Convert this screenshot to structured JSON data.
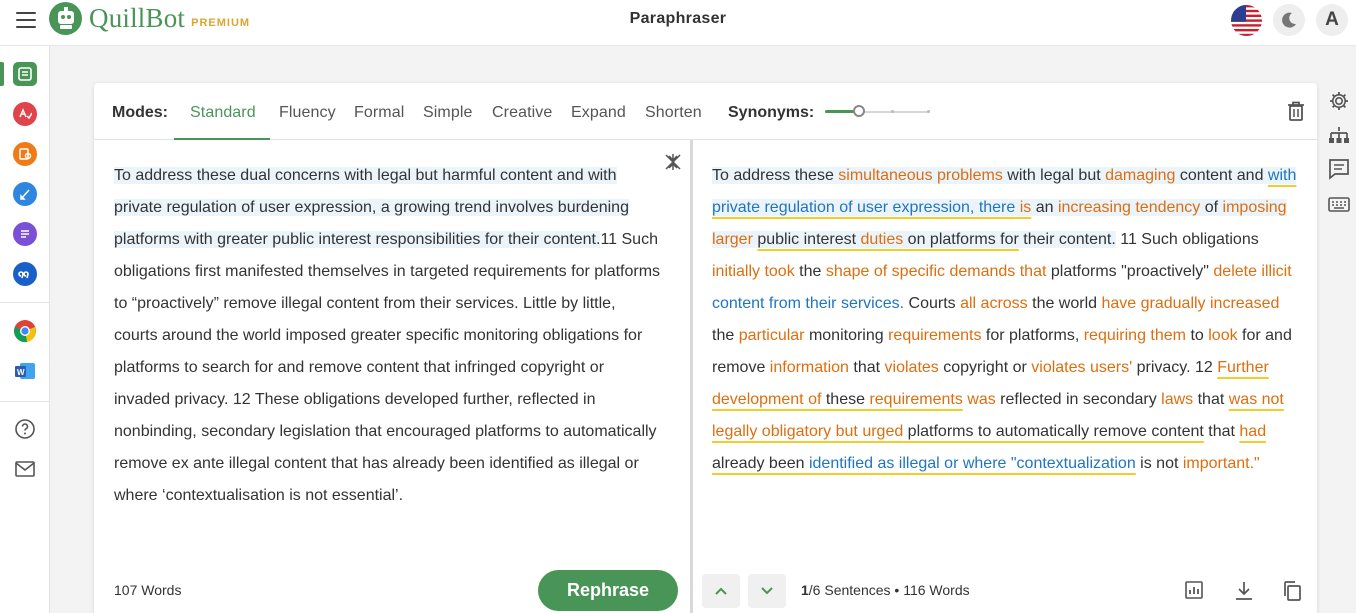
{
  "app": {
    "brand": "QuillBot",
    "tier": "PREMIUM",
    "title": "Paraphraser",
    "avatar_letter": "A",
    "brand_color": "#499557"
  },
  "toolbar": {
    "modes_label": "Modes:",
    "modes": [
      "Standard",
      "Fluency",
      "Formal",
      "Simple",
      "Creative",
      "Expand",
      "Shorten"
    ],
    "active_mode": "Standard",
    "synonyms_label": "Synonyms:",
    "synonyms_level": 0.3
  },
  "sidebar": {
    "items": [
      {
        "icon": "paraphraser-icon",
        "color": "#499557"
      },
      {
        "icon": "grammar-checker-icon",
        "color": "#e0434a"
      },
      {
        "icon": "plagiarism-checker-icon",
        "color": "#f07b16"
      },
      {
        "icon": "co-writer-icon",
        "color": "#2f86e0"
      },
      {
        "icon": "summarizer-icon",
        "color": "#7950d6"
      },
      {
        "icon": "citation-generator-icon",
        "color": "#1a5fc7"
      },
      {
        "icon": "chrome-extension-icon",
        "color": "#db4437"
      },
      {
        "icon": "word-addin-icon",
        "color": "#2b5eb3"
      },
      {
        "icon": "help-icon",
        "color": "#555555"
      },
      {
        "icon": "mail-icon",
        "color": "#555555"
      }
    ]
  },
  "input": {
    "highlighted": "To address these dual concerns with legal but harmful content and with private regulation of user expression, a growing trend involves burdening platforms with greater public interest responsibilities for their content.",
    "rest": "11 Such obligations first manifested themselves in targeted requirements for platforms to “proactively” remove illegal content from their services. Little by little, courts around the world imposed greater specific monitoring obligations for platforms to search for and remove content that infringed copyright or invaded privacy. 12 These obligations developed further, reflected in nonbinding, secondary legislation that encouraged platforms to automatically remove ex ante illegal content that has already been identified as illegal or where ‘contextualisation is not essential’.",
    "word_count": "107 Words",
    "rephrase_label": "Rephrase"
  },
  "output": {
    "segments": [
      {
        "t": "To address these ",
        "c": "n",
        "hl": true
      },
      {
        "t": "simultaneous problems",
        "c": "or",
        "hl": true
      },
      {
        "t": " with legal but ",
        "c": "n",
        "hl": true
      },
      {
        "t": "damaging",
        "c": "or",
        "hl": true
      },
      {
        "t": " content",
        "c": "n",
        "hl": true
      },
      {
        "t": " and ",
        "c": "n",
        "hl": true
      },
      {
        "t": "with private regulation of user expression, there",
        "c": "bl",
        "hl": true,
        "u": true
      },
      {
        "t": " is",
        "c": "or",
        "hl": true,
        "u": true
      },
      {
        "t": " an ",
        "c": "n",
        "hl": true
      },
      {
        "t": "increasing",
        "c": "or",
        "hl": true
      },
      {
        "t": " ",
        "c": "n",
        "hl": true
      },
      {
        "t": "tendency",
        "c": "or",
        "hl": true
      },
      {
        "t": " of ",
        "c": "n",
        "hl": true
      },
      {
        "t": "imposing larger",
        "c": "or",
        "hl": true
      },
      {
        "t": " ",
        "c": "n",
        "hl": true
      },
      {
        "t": "public interest ",
        "c": "n",
        "hl": true,
        "u": true
      },
      {
        "t": "duties",
        "c": "or",
        "hl": true,
        "u": true
      },
      {
        "t": " on platforms for",
        "c": "n",
        "hl": true,
        "u": true
      },
      {
        "t": " their content.",
        "c": "n",
        "hl": true
      },
      {
        "t": " 11 Such obligations ",
        "c": "n"
      },
      {
        "t": "initially took",
        "c": "or"
      },
      {
        "t": " the ",
        "c": "n"
      },
      {
        "t": "shape of specific demands that",
        "c": "or"
      },
      {
        "t": " platforms \"proactively\" ",
        "c": "n"
      },
      {
        "t": "delete illicit",
        "c": "or"
      },
      {
        "t": " ",
        "c": "n"
      },
      {
        "t": "content from their services.",
        "c": "bl"
      },
      {
        "t": " Courts ",
        "c": "n"
      },
      {
        "t": "all across",
        "c": "or"
      },
      {
        "t": " the world ",
        "c": "n"
      },
      {
        "t": "have gradually increased",
        "c": "or"
      },
      {
        "t": " the ",
        "c": "n"
      },
      {
        "t": "particular",
        "c": "or"
      },
      {
        "t": " monitoring ",
        "c": "n"
      },
      {
        "t": "requirements",
        "c": "or"
      },
      {
        "t": " for platforms, ",
        "c": "n"
      },
      {
        "t": "requiring them",
        "c": "or"
      },
      {
        "t": " to ",
        "c": "n"
      },
      {
        "t": "look",
        "c": "or"
      },
      {
        "t": " for and remove ",
        "c": "n"
      },
      {
        "t": "information",
        "c": "or"
      },
      {
        "t": " that ",
        "c": "n"
      },
      {
        "t": "violates",
        "c": "or"
      },
      {
        "t": " copyright or ",
        "c": "n"
      },
      {
        "t": "violates users'",
        "c": "or"
      },
      {
        "t": " privacy. 12 ",
        "c": "n"
      },
      {
        "t": "Further development of",
        "c": "or",
        "u": true
      },
      {
        "t": " these ",
        "c": "n",
        "u": true
      },
      {
        "t": "requirements",
        "c": "or",
        "u": true
      },
      {
        "t": " ",
        "c": "n"
      },
      {
        "t": "was",
        "c": "or"
      },
      {
        "t": " reflected in secondary ",
        "c": "n"
      },
      {
        "t": "laws",
        "c": "or"
      },
      {
        "t": " that ",
        "c": "n"
      },
      {
        "t": "was not",
        "c": "or",
        "u": true
      },
      {
        "t": " ",
        "c": "n",
        "u": true
      },
      {
        "t": "legally obligatory but urged",
        "c": "or",
        "u": true
      },
      {
        "t": " platforms to automatically remove content",
        "c": "n",
        "u": true
      },
      {
        "t": " that ",
        "c": "n"
      },
      {
        "t": "had",
        "c": "or",
        "u": true
      },
      {
        "t": " already been ",
        "c": "n",
        "u": true
      },
      {
        "t": "identified as illegal or where \"contextualization",
        "c": "bl",
        "u": true
      },
      {
        "t": " is not ",
        "c": "n"
      },
      {
        "t": "important.\"",
        "c": "or"
      }
    ],
    "sentence_info": "1/6 Sentences",
    "bullet": "•",
    "word_count": "116 Words"
  },
  "colors": {
    "changed_word": "#dd6e0f",
    "structural_change": "#1f74c4",
    "longest_unchanged": "#f2cd27",
    "highlight": "#ebf4fb"
  }
}
